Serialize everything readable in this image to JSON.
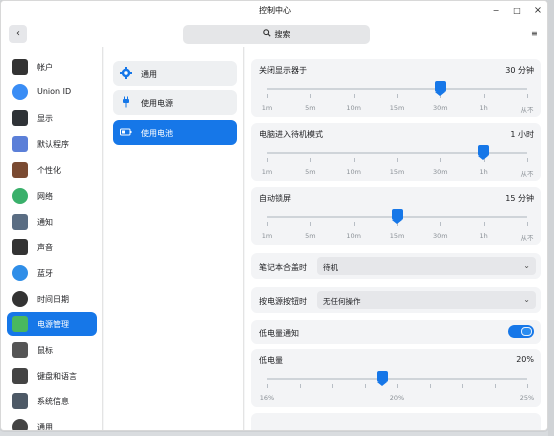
{
  "window": {
    "title": "控制中心",
    "minimize": "−",
    "maximize": "□",
    "close": "×"
  },
  "toolbar": {
    "back": "‹",
    "search_placeholder": "搜索",
    "search_icon": "🔍",
    "menu": "≡"
  },
  "sidebar": {
    "items": [
      {
        "label": "帐户",
        "icon": "account-icon",
        "color": "#333333"
      },
      {
        "label": "Union ID",
        "icon": "cloud-icon",
        "color": "#3a8df5"
      },
      {
        "label": "显示",
        "icon": "display-icon",
        "color": "#2f3337"
      },
      {
        "label": "默认程序",
        "icon": "default-apps-icon",
        "color": "#5b7fd8"
      },
      {
        "label": "个性化",
        "icon": "palette-icon",
        "color": "#7a4a32"
      },
      {
        "label": "网络",
        "icon": "network-icon",
        "color": "#3ab06b"
      },
      {
        "label": "通知",
        "icon": "notification-icon",
        "color": "#5a6d83"
      },
      {
        "label": "声音",
        "icon": "sound-icon",
        "color": "#333333"
      },
      {
        "label": "蓝牙",
        "icon": "bluetooth-icon",
        "color": "#2f8ee8"
      },
      {
        "label": "时间日期",
        "icon": "clock-icon",
        "color": "#333333"
      },
      {
        "label": "电源管理",
        "icon": "power-icon",
        "color": "#49b85e"
      },
      {
        "label": "鼠标",
        "icon": "mouse-icon",
        "color": "#555555"
      },
      {
        "label": "键盘和语言",
        "icon": "keyboard-icon",
        "color": "#444444"
      },
      {
        "label": "系统信息",
        "icon": "system-info-icon",
        "color": "#4d5966"
      },
      {
        "label": "通用",
        "icon": "general-icon",
        "color": "#444444"
      }
    ],
    "active_index": 10
  },
  "subnav": {
    "items": [
      {
        "label": "通用",
        "icon": "gear-icon"
      },
      {
        "label": "使用电源",
        "icon": "plug-icon"
      },
      {
        "label": "使用电池",
        "icon": "battery-icon"
      }
    ],
    "active_index": 2
  },
  "settings": {
    "monitor_off": {
      "title": "关闭显示器于",
      "value": "30 分钟",
      "position_fraction": 0.6667
    },
    "standby": {
      "title": "电脑进入待机模式",
      "value": "1 小时",
      "position_fraction": 0.8333
    },
    "auto_lock": {
      "title": "自动锁屏",
      "value": "15 分钟",
      "position_fraction": 0.5
    },
    "ticks": [
      "1m",
      "5m",
      "10m",
      "15m",
      "30m",
      "1h",
      "从不"
    ],
    "lid": {
      "label": "笔记本合盖时",
      "value": "待机"
    },
    "power_button": {
      "label": "按电源按钮时",
      "value": "无任何操作"
    },
    "low_battery_notify": {
      "label": "低电量通知",
      "enabled": true
    },
    "low_battery": {
      "title": "低电量",
      "value": "20%",
      "position_fraction": 0.4444,
      "ticks": [
        "16%",
        "20%",
        "25%"
      ]
    }
  },
  "accent": "#1677e8"
}
